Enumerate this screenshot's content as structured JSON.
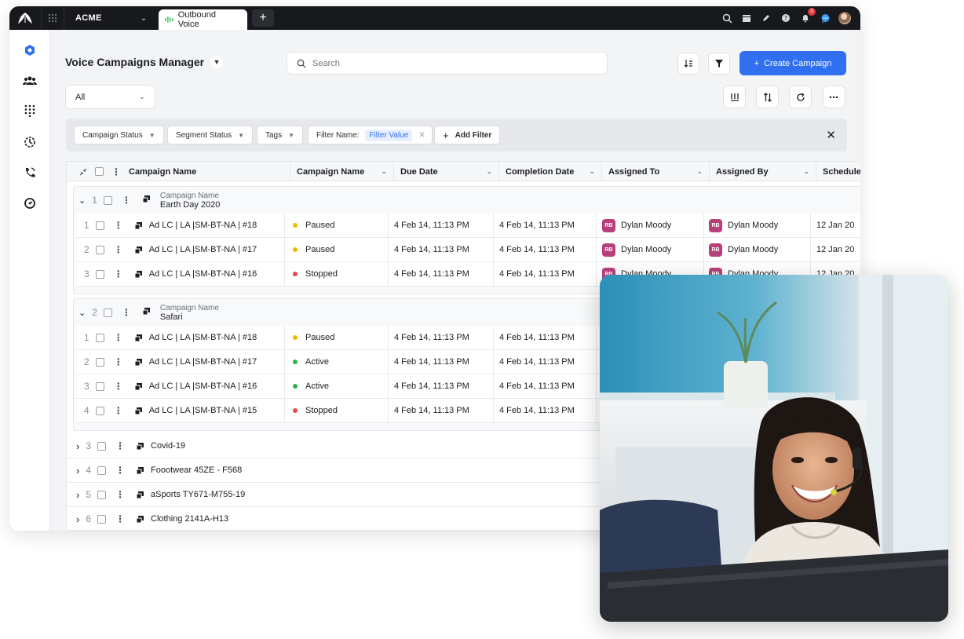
{
  "topbar": {
    "org": "ACME",
    "tab_label": "Outbound Voice",
    "notification_count": "3"
  },
  "page": {
    "title": "Voice Campaigns Manager",
    "search_placeholder": "Search",
    "create_label": "Create Campaign",
    "view_select": "All"
  },
  "filters": {
    "chips": [
      "Campaign Status",
      "Segment Status",
      "Tags"
    ],
    "filter_name_label": "Filter Name:",
    "filter_value": "Filter Value",
    "add_filter": "Add Filter"
  },
  "table": {
    "columns": [
      "Campaign Name",
      "Campaign Name",
      "Due Date",
      "Completion Date",
      "Assigned To",
      "Assigned By",
      "Schedule"
    ],
    "groups": [
      {
        "index": "1",
        "label": "Campaign Name",
        "name": "Earth Day 2020",
        "rows": [
          {
            "index": "1",
            "name": "Ad LC | LA |SM-BT-NA | #18",
            "status": "Paused",
            "due": "4 Feb 14, 11:13 PM",
            "completion": "4 Feb 14, 11:13 PM",
            "assigned_to": "Dylan Moody",
            "assigned_by": "Dylan Moody",
            "initials": "RB",
            "schedule": "12 Jan 20"
          },
          {
            "index": "2",
            "name": "Ad LC | LA |SM-BT-NA | #17",
            "status": "Paused",
            "due": "4 Feb 14, 11:13 PM",
            "completion": "4 Feb 14, 11:13 PM",
            "assigned_to": "Dylan Moody",
            "assigned_by": "Dylan Moody",
            "initials": "RB",
            "schedule": "12 Jan 20"
          },
          {
            "index": "3",
            "name": "Ad LC | LA |SM-BT-NA | #16",
            "status": "Stopped",
            "due": "4 Feb 14, 11:13 PM",
            "completion": "4 Feb 14, 11:13 PM",
            "assigned_to": "Dylan Moody",
            "assigned_by": "Dylan Moody",
            "initials": "RB",
            "schedule": "12 Jan 20"
          }
        ]
      },
      {
        "index": "2",
        "label": "Campaign Name",
        "name": "Safari",
        "rows": [
          {
            "index": "1",
            "name": "Ad LC | LA |SM-BT-NA | #18",
            "status": "Paused",
            "due": "4 Feb 14, 11:13 PM",
            "completion": "4 Feb 14, 11:13 PM"
          },
          {
            "index": "2",
            "name": "Ad LC | LA |SM-BT-NA | #17",
            "status": "Active",
            "due": "4 Feb 14, 11:13 PM",
            "completion": "4 Feb 14, 11:13 PM"
          },
          {
            "index": "3",
            "name": "Ad LC | LA |SM-BT-NA | #16",
            "status": "Active",
            "due": "4 Feb 14, 11:13 PM",
            "completion": "4 Feb 14, 11:13 PM"
          },
          {
            "index": "4",
            "name": "Ad LC | LA |SM-BT-NA | #15",
            "status": "Stopped",
            "due": "4 Feb 14, 11:13 PM",
            "completion": "4 Feb 14, 11:13 PM"
          }
        ]
      }
    ],
    "collapsed": [
      {
        "index": "3",
        "name": "Covid-19"
      },
      {
        "index": "4",
        "name": "Foootwear 45ZE - F568"
      },
      {
        "index": "5",
        "name": "aSports TY671-M755-19"
      },
      {
        "index": "6",
        "name": "Clothing 2141A-H13"
      }
    ]
  },
  "colors": {
    "accent": "#2f6ff0",
    "paused": "#f5b800",
    "active": "#2bb34a",
    "stopped": "#e84a4a",
    "avatar": "#b8407a"
  }
}
